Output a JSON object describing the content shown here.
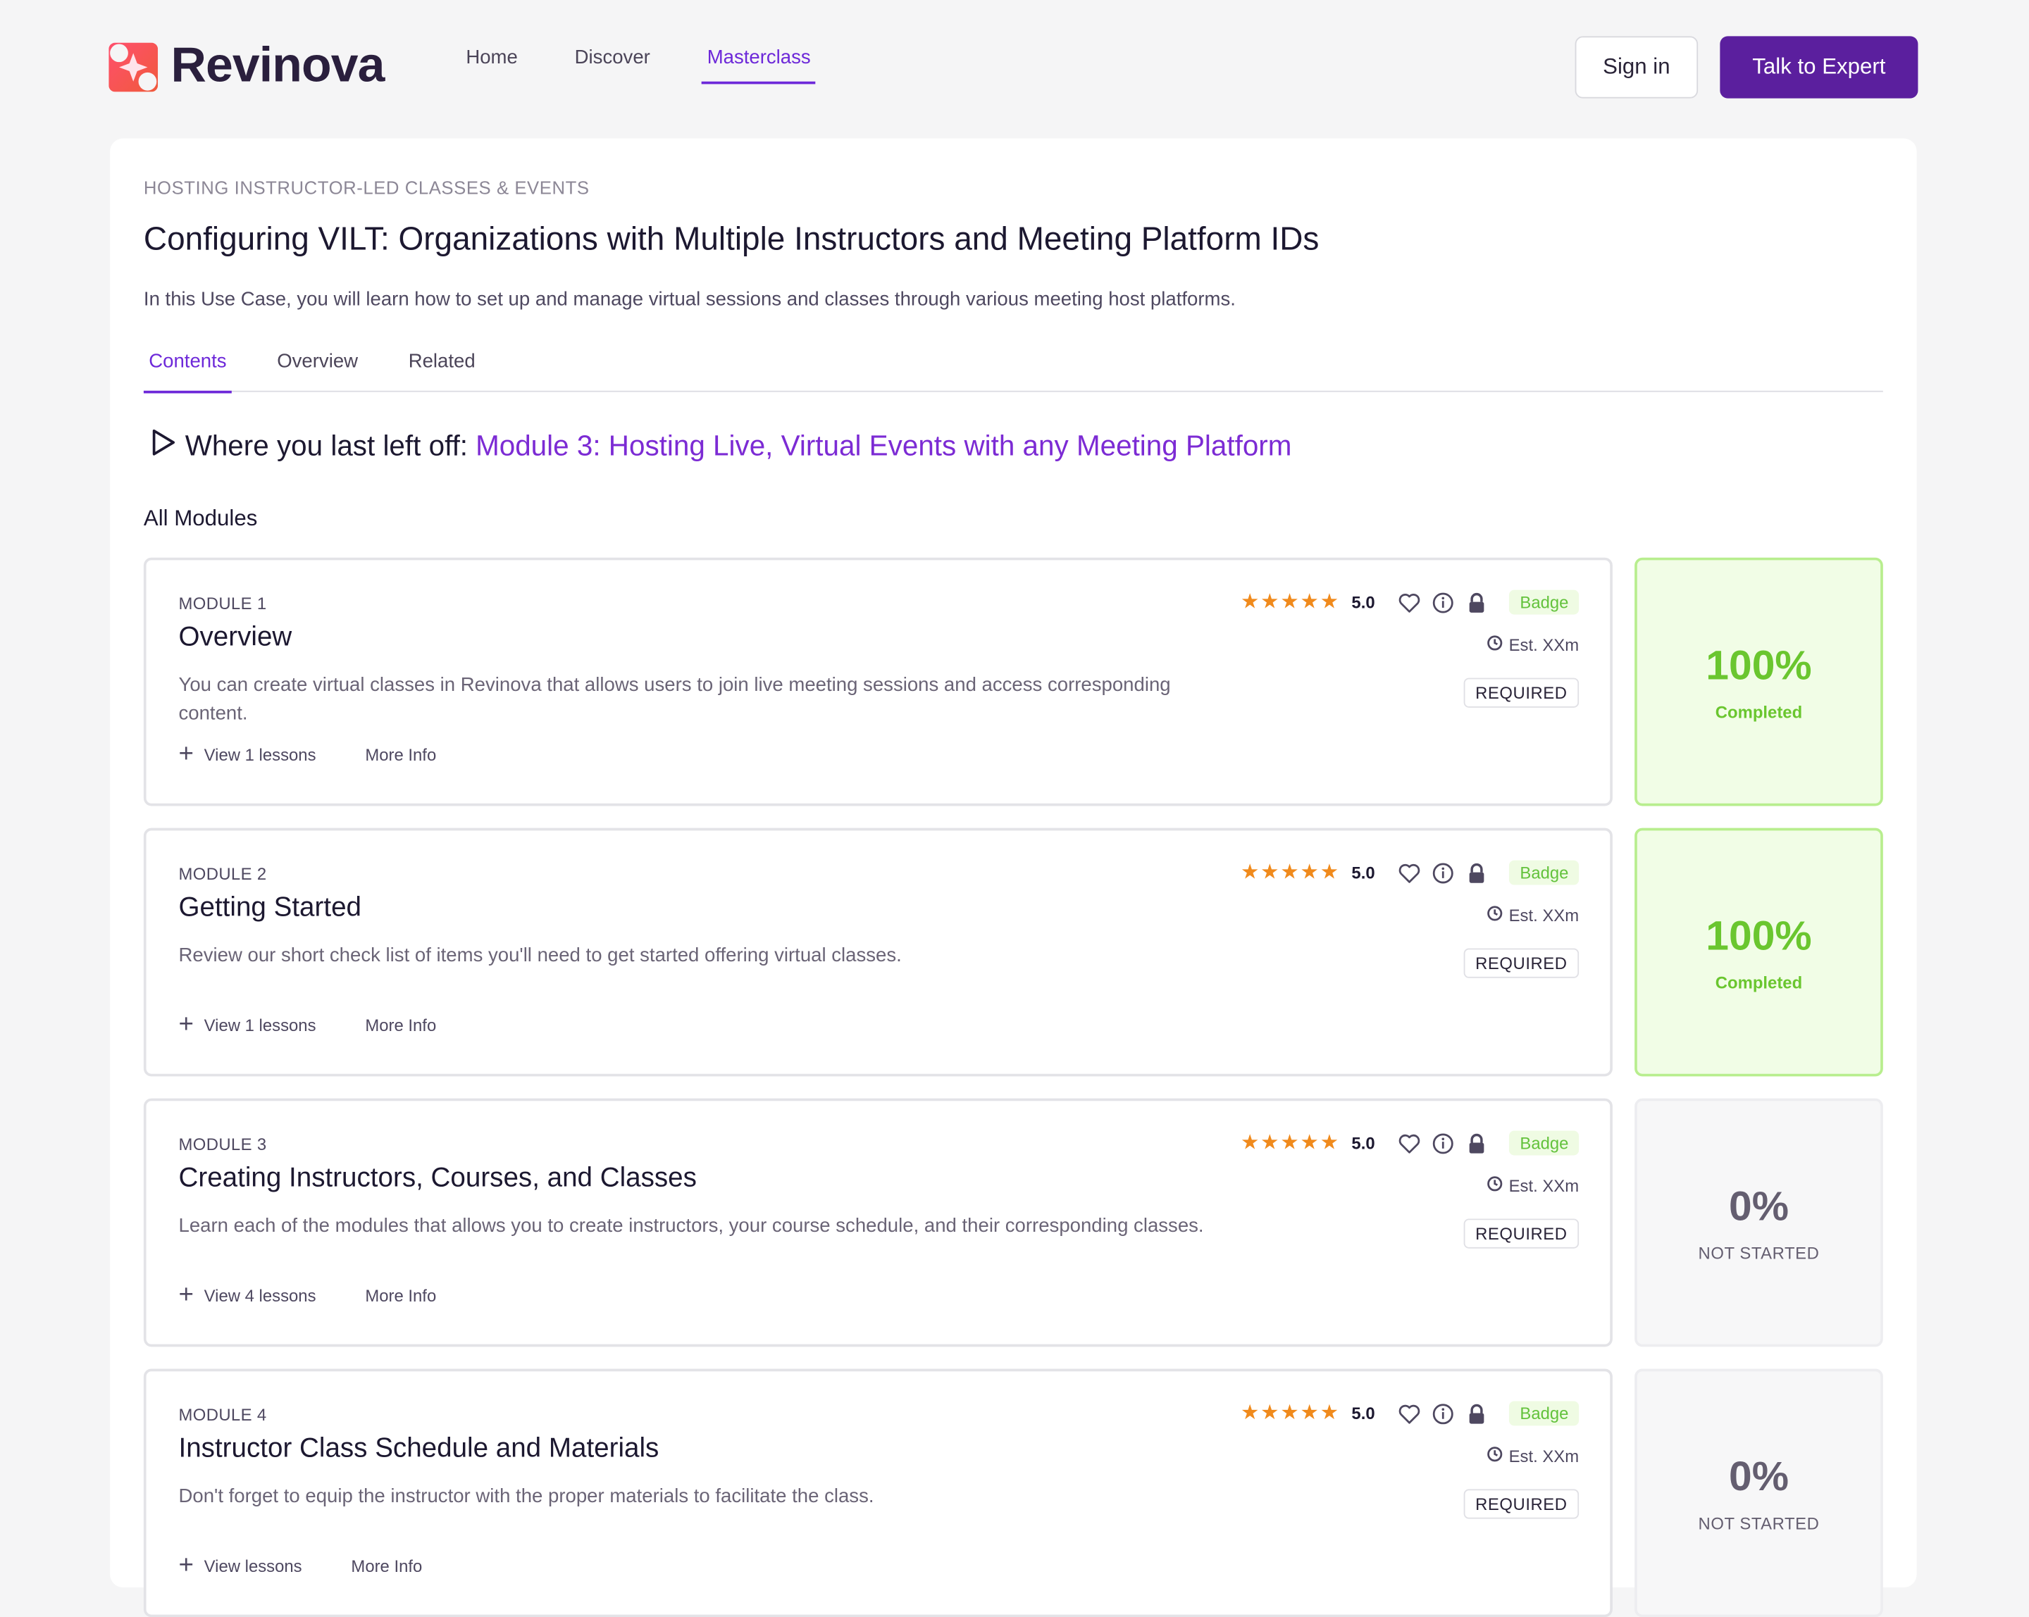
{
  "brand": {
    "name": "Revinova"
  },
  "nav": {
    "items": [
      {
        "label": "Home"
      },
      {
        "label": "Discover"
      },
      {
        "label": "Masterclass"
      }
    ]
  },
  "header": {
    "signin_label": "Sign in",
    "expert_label": "Talk to Expert"
  },
  "course": {
    "eyebrow": "HOSTING INSTRUCTOR-LED CLASSES & EVENTS",
    "title": "Configuring VILT: Organizations with Multiple Instructors and Meeting Platform IDs",
    "description": "In this Use Case, you will learn how to set up and manage virtual sessions and classes through various meeting host platforms."
  },
  "tabs": [
    {
      "label": "Contents"
    },
    {
      "label": "Overview"
    },
    {
      "label": "Related"
    }
  ],
  "resume": {
    "prefix": "Where you last left off:",
    "link": "Module 3: Hosting Live, Virtual Events with any Meeting Platform"
  },
  "modules_heading": "All Modules",
  "modules": [
    {
      "number": "MODULE 1",
      "title": "Overview",
      "description": "You can create virtual classes in Revinova that allows users to join live meeting sessions and access corresponding content.",
      "lessons": "View 1 lessons",
      "more": "More Info",
      "rating": "5.0",
      "badge": "Badge",
      "est": "Est. XXm",
      "required": "REQUIRED",
      "progress": "100%",
      "status": "Completed"
    },
    {
      "number": "MODULE 2",
      "title": "Getting Started",
      "description": "Review our short check list of items you'll need to get started offering virtual classes.",
      "lessons": "View 1 lessons",
      "more": "More Info",
      "rating": "5.0",
      "badge": "Badge",
      "est": "Est. XXm",
      "required": "REQUIRED",
      "progress": "100%",
      "status": "Completed"
    },
    {
      "number": "MODULE 3",
      "title": "Creating Instructors, Courses, and Classes",
      "description": "Learn each of the modules that allows you to create instructors, your course schedule, and their corresponding classes.",
      "lessons": "View 4 lessons",
      "more": "More Info",
      "rating": "5.0",
      "badge": "Badge",
      "est": "Est. XXm",
      "required": "REQUIRED",
      "progress": "0%",
      "status": "NOT STARTED"
    },
    {
      "number": "MODULE 4",
      "title": "Instructor Class Schedule and Materials",
      "description": "Don't forget to equip the instructor with the proper materials to facilitate the class.",
      "lessons": "View lessons",
      "more": "More Info",
      "rating": "5.0",
      "badge": "Badge",
      "est": "Est. XXm",
      "required": "REQUIRED",
      "progress": "0%",
      "status": "NOT STARTED"
    }
  ],
  "colors": {
    "accent": "#6d28d9",
    "brand_button": "#5b1f9e",
    "complete": "#6ac62f",
    "star": "#f08a1c"
  },
  "icons": [
    "play-outline-icon",
    "star-icon",
    "heart-icon",
    "info-icon",
    "lock-icon",
    "clock-icon",
    "plus-icon"
  ]
}
